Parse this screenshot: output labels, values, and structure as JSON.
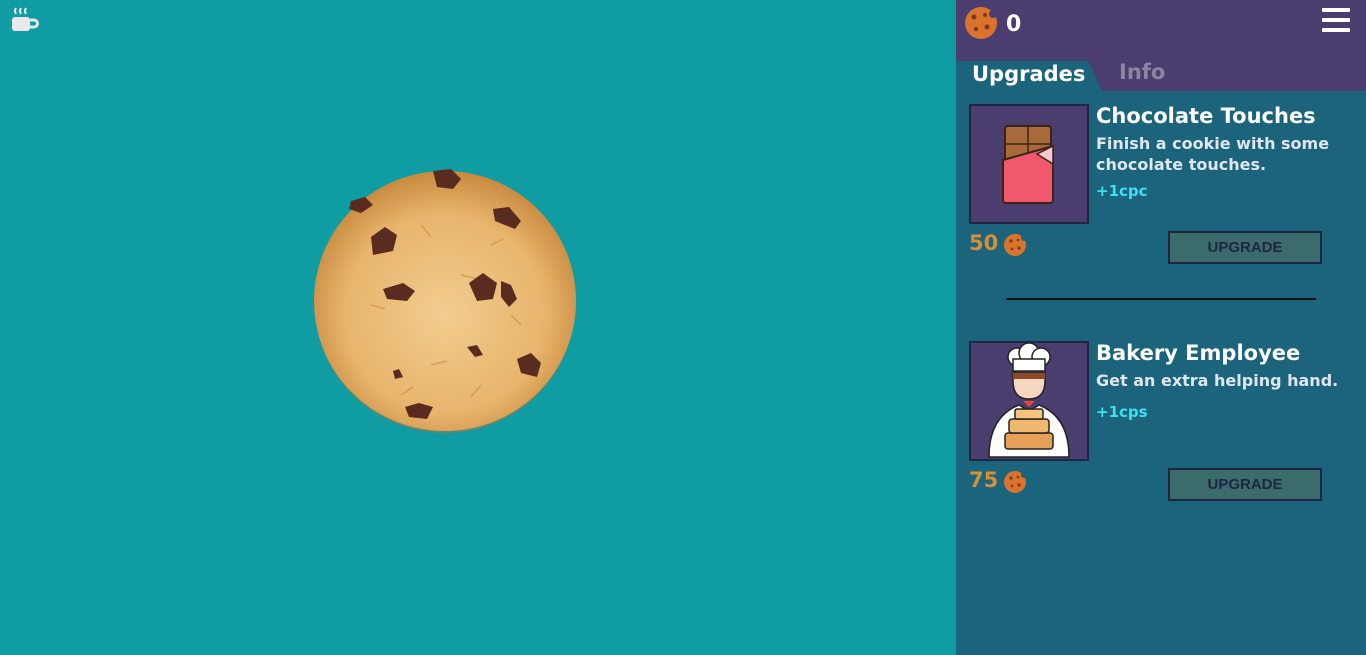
{
  "header": {
    "cookie_count": "0"
  },
  "tabs": {
    "upgrades": "Upgrades",
    "info": "Info"
  },
  "upgrades": [
    {
      "title": "Chocolate Touches",
      "description": "Finish a cookie with some chocolate touches.",
      "effect": "+1cpc",
      "price": "50",
      "button": "UPGRADE",
      "icon": "chocolate-bar-icon"
    },
    {
      "title": "Bakery Employee",
      "description": "Get an extra helping hand.",
      "effect": "+1cps",
      "price": "75",
      "button": "UPGRADE",
      "icon": "baker-icon"
    }
  ],
  "colors": {
    "background": "#0f9ca3",
    "panel": "#1b647b",
    "header": "#4b3d6d",
    "price": "#d48f39",
    "effect": "#3ee0f5"
  }
}
